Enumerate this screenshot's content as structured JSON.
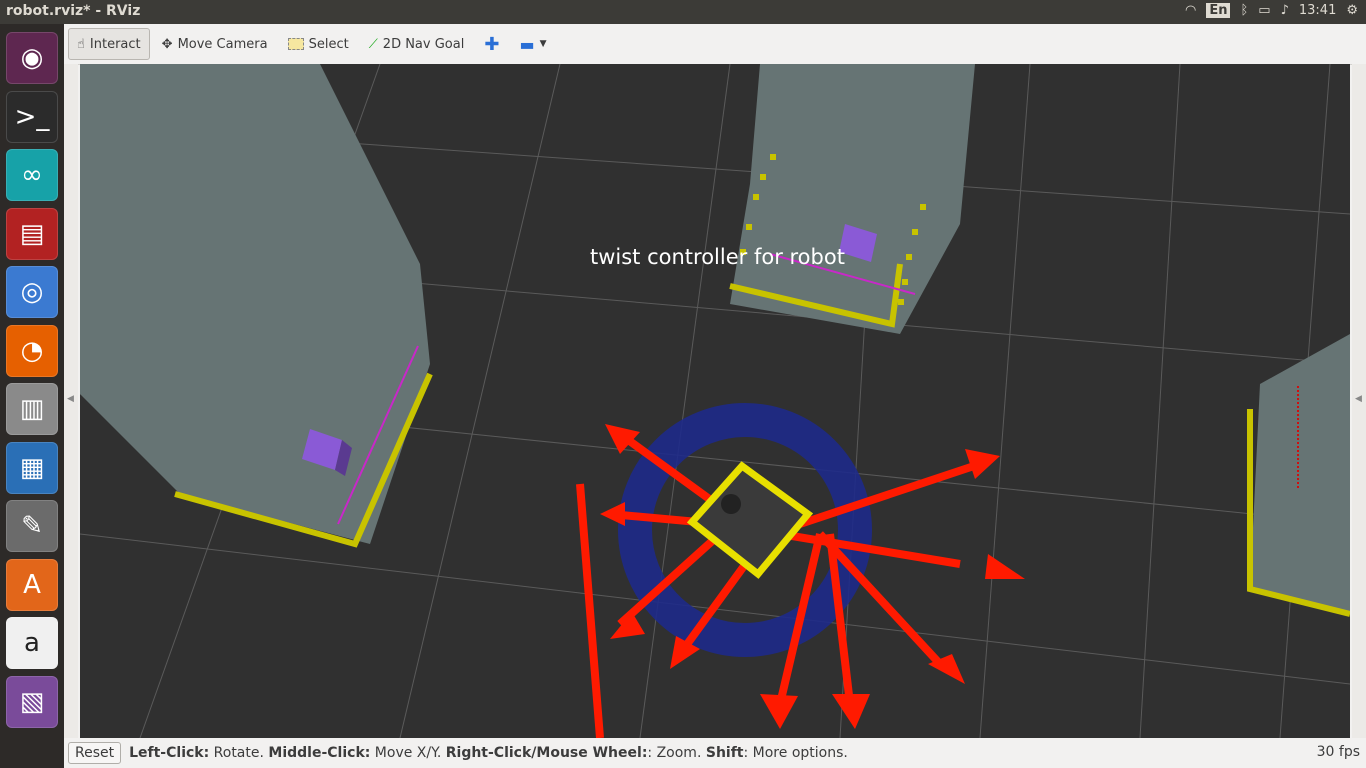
{
  "window": {
    "title": "robot.rviz* - RViz"
  },
  "tray": {
    "lang": "En",
    "clock": "13:41"
  },
  "launcher": {
    "items": [
      {
        "name": "ubuntu",
        "icon": "ubuntu-logo-icon",
        "color": "#5e2750",
        "glyph": "◉"
      },
      {
        "name": "terminal",
        "icon": "terminal-icon",
        "color": "#2b2b2b",
        "glyph": ">_"
      },
      {
        "name": "arduino",
        "icon": "arduino-icon",
        "color": "#17a2a8",
        "glyph": "∞"
      },
      {
        "name": "app-red",
        "icon": "red-app-icon",
        "color": "#b22222",
        "glyph": "▤"
      },
      {
        "name": "chrome",
        "icon": "chrome-icon",
        "color": "#3b7ad1",
        "glyph": "◎"
      },
      {
        "name": "firefox",
        "icon": "firefox-icon",
        "color": "#e66000",
        "glyph": "◔"
      },
      {
        "name": "files",
        "icon": "file-cabinet-icon",
        "color": "#8a8a8a",
        "glyph": "▥"
      },
      {
        "name": "writer",
        "icon": "document-icon",
        "color": "#2a6fb6",
        "glyph": "▦"
      },
      {
        "name": "editor",
        "icon": "text-editor-icon",
        "color": "#6b6b6b",
        "glyph": "✎"
      },
      {
        "name": "software",
        "icon": "software-center-icon",
        "color": "#e2661a",
        "glyph": "A"
      },
      {
        "name": "amazon",
        "icon": "amazon-icon",
        "color": "#f0f0f0",
        "glyph": "a"
      },
      {
        "name": "workspaces",
        "icon": "workspace-icon",
        "color": "#7a4b9a",
        "glyph": "▧"
      }
    ]
  },
  "toolbar": {
    "interact": "Interact",
    "move_camera": "Move Camera",
    "select": "Select",
    "nav_goal": "2D Nav Goal",
    "add_icon": "plus-icon",
    "remove_icon": "minus-icon"
  },
  "scene": {
    "marker_text": "twist  controller  for  robot",
    "colors": {
      "background": "#303030",
      "map": "#667474",
      "wall": "#c8c300",
      "arrow": "#ff1a00",
      "ring": "#1e2a8a",
      "box": "#8a5ad6",
      "laser": "#c828c8"
    }
  },
  "status": {
    "reset": "Reset",
    "lc": "Left-Click:",
    "lc_t": " Rotate. ",
    "mc": "Middle-Click:",
    "mc_t": " Move X/Y. ",
    "rc": "Right-Click/Mouse Wheel:",
    "rc_t": ": Zoom. ",
    "sh": "Shift",
    "sh_t": ": More options.",
    "fps": "30 fps"
  }
}
